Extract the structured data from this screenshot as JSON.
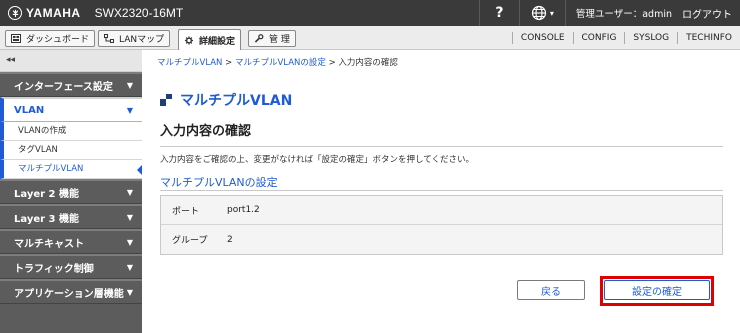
{
  "header": {
    "brand": "YAMAHA",
    "model": "SWX2320-16MT",
    "help_label": "?",
    "language_caret": "▾",
    "user_label": "管理ユーザー：admin",
    "logout_label": "ログアウト"
  },
  "tabs": [
    {
      "label": "ダッシュボード",
      "icon": "dashboard-icon"
    },
    {
      "label": "LANマップ",
      "icon": "lan-map-icon"
    },
    {
      "label": "詳細設定",
      "icon": "gear-icon",
      "active": true
    },
    {
      "label": "管 理",
      "icon": "wrench-icon"
    }
  ],
  "right_links": [
    "CONSOLE",
    "CONFIG",
    "SYSLOG",
    "TECHINFO"
  ],
  "sidebar": {
    "collapse_label": "◂◂",
    "items": [
      {
        "label": "インターフェース設定",
        "arrow": "▼"
      },
      {
        "label": "VLAN",
        "arrow": "▼"
      },
      {
        "label": "Layer 2 機能",
        "arrow": "▼"
      },
      {
        "label": "Layer 3 機能",
        "arrow": "▼"
      },
      {
        "label": "マルチキャスト",
        "arrow": "▼"
      },
      {
        "label": "トラフィック制御",
        "arrow": "▼"
      },
      {
        "label": "アプリケーション層機能",
        "arrow": "▼"
      }
    ],
    "vlan_sub": [
      "VLANの作成",
      "タグVLAN",
      "マルチプルVLAN"
    ]
  },
  "breadcrumb": {
    "part1": "マルチプルVLAN",
    "sep": " > ",
    "part2": "マルチプルVLANの設定",
    "part3": "入力内容の確認"
  },
  "main": {
    "section_title": "マルチプルVLAN",
    "page_title": "入力内容の確認",
    "description": "入力内容をご確認の上、変更がなければ「設定の確定」ボタンを押してください。",
    "subsection_title": "マルチプルVLANの設定",
    "rows": [
      {
        "key": "ポート",
        "value": "port1.2"
      },
      {
        "key": "グループ",
        "value": "2"
      }
    ],
    "back_label": "戻る",
    "confirm_label": "設定の確定"
  },
  "colors": {
    "accent": "#1f5bd6",
    "highlight": "#e00000",
    "topbar": "#3a3a3a",
    "sidebar": "#5c5c5c"
  }
}
